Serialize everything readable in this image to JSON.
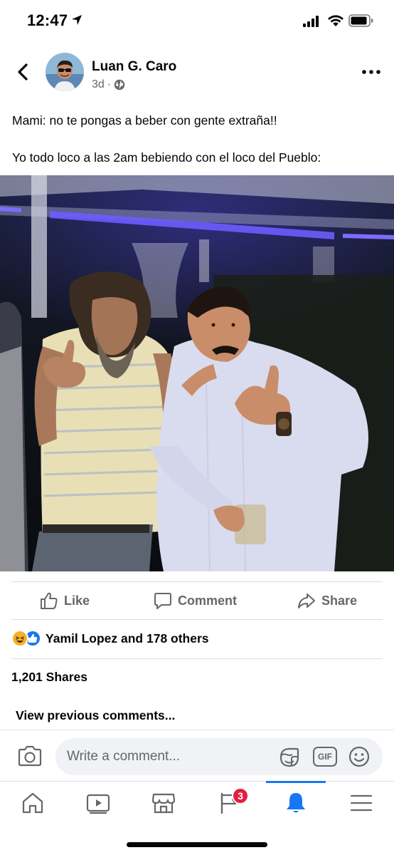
{
  "status_bar": {
    "time": "12:47"
  },
  "post": {
    "author_name": "Luan G. Caro",
    "timestamp": "3d",
    "separator": "·",
    "privacy_icon": "globe-icon",
    "text_lines": [
      "Mami: no te pongas a beber con gente extraña!!",
      "Yo todo loco a las 2am bebiendo con el loco del Pueblo:"
    ]
  },
  "actions": {
    "like": "Like",
    "comment": "Comment",
    "share": "Share"
  },
  "reactions": {
    "types": [
      "haha",
      "like"
    ],
    "summary": "Yamil Lopez and 178 others"
  },
  "shares_text": "1,201 Shares",
  "view_previous": "View previous comments...",
  "comment_bar": {
    "placeholder": "Write a comment...",
    "gif_label": "GIF"
  },
  "bottom_nav": {
    "items": [
      "home-icon",
      "watch-icon",
      "marketplace-icon",
      "pages-icon",
      "notifications-icon",
      "menu-icon"
    ],
    "active": "notifications-icon",
    "badge_count": "3"
  },
  "colors": {
    "brand_blue": "#1877f2",
    "secondary_text": "#65676b",
    "badge_red": "#e41e3f"
  }
}
